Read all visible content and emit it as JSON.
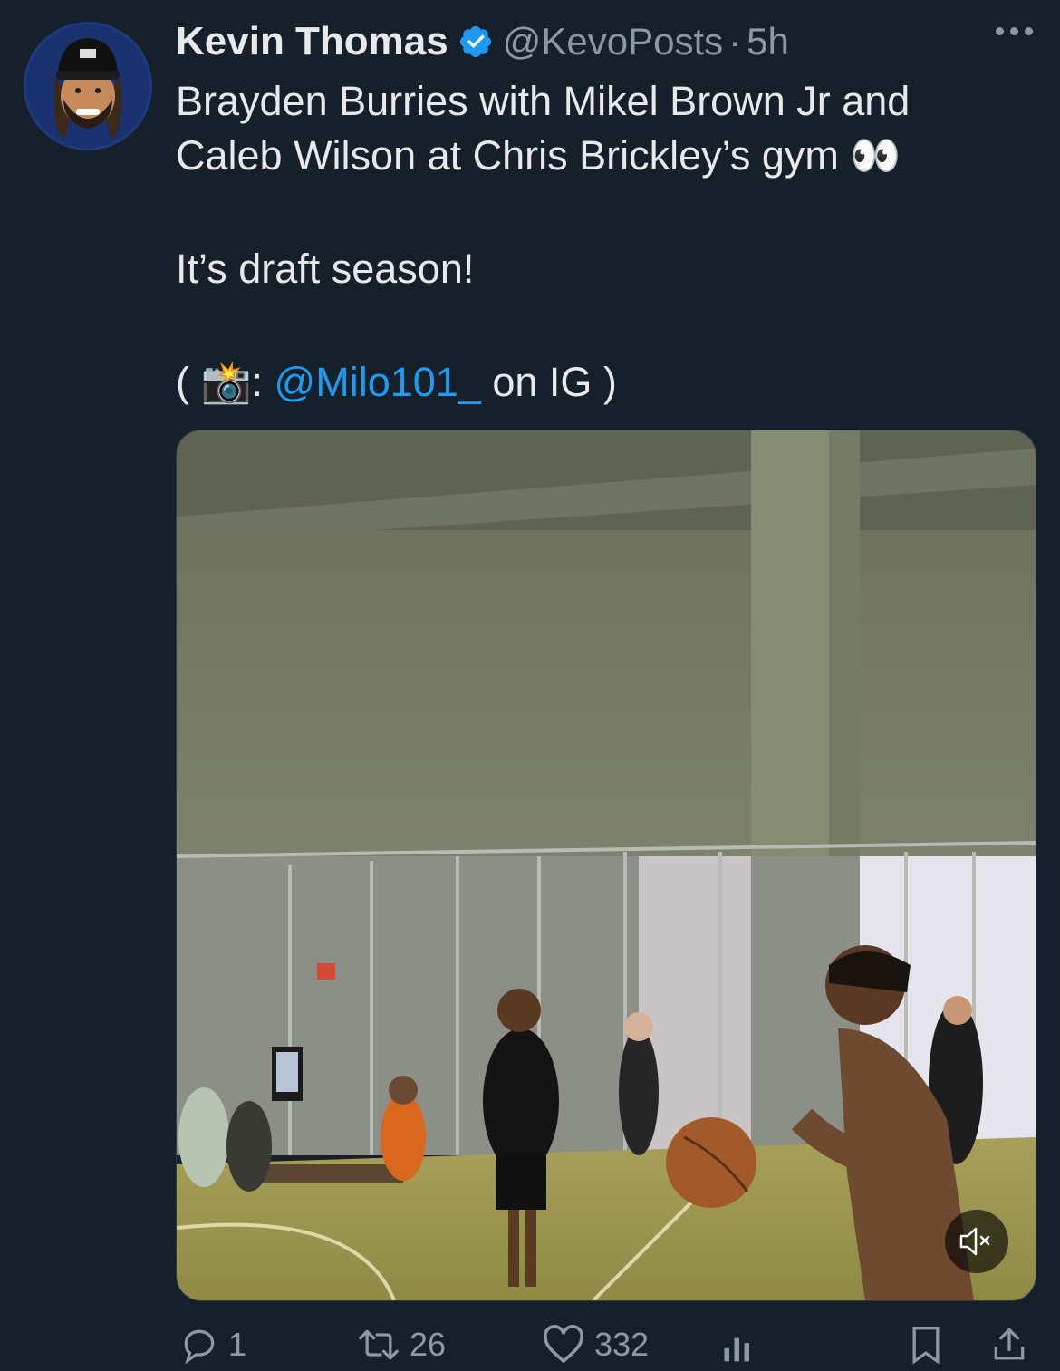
{
  "tweet": {
    "author_name": "Kevin Thomas",
    "handle": "@KevoPosts",
    "separator": "·",
    "time": "5h",
    "line1": "Brayden Burries with Mikel Brown Jr and",
    "line2": "Caleb Wilson at Chris Brickley’s gym 👀",
    "line3": "It’s draft season!",
    "credit_open": "( 📸: ",
    "credit_mention": "@Milo101_",
    "credit_close": " on IG )"
  },
  "actions": {
    "replies": "1",
    "reposts": "26",
    "likes": "332"
  },
  "icons": {
    "verified": "verified-badge-icon",
    "more": "more-options-icon",
    "mute": "muted-speaker-icon",
    "reply": "reply-icon",
    "repost": "repost-icon",
    "like": "heart-icon",
    "views": "views-icon",
    "bookmark": "bookmark-icon",
    "share": "share-icon"
  },
  "colors": {
    "background": "#15202b",
    "text": "#e7e9ea",
    "muted": "#8b98a5",
    "accent": "#1d9bf0"
  }
}
